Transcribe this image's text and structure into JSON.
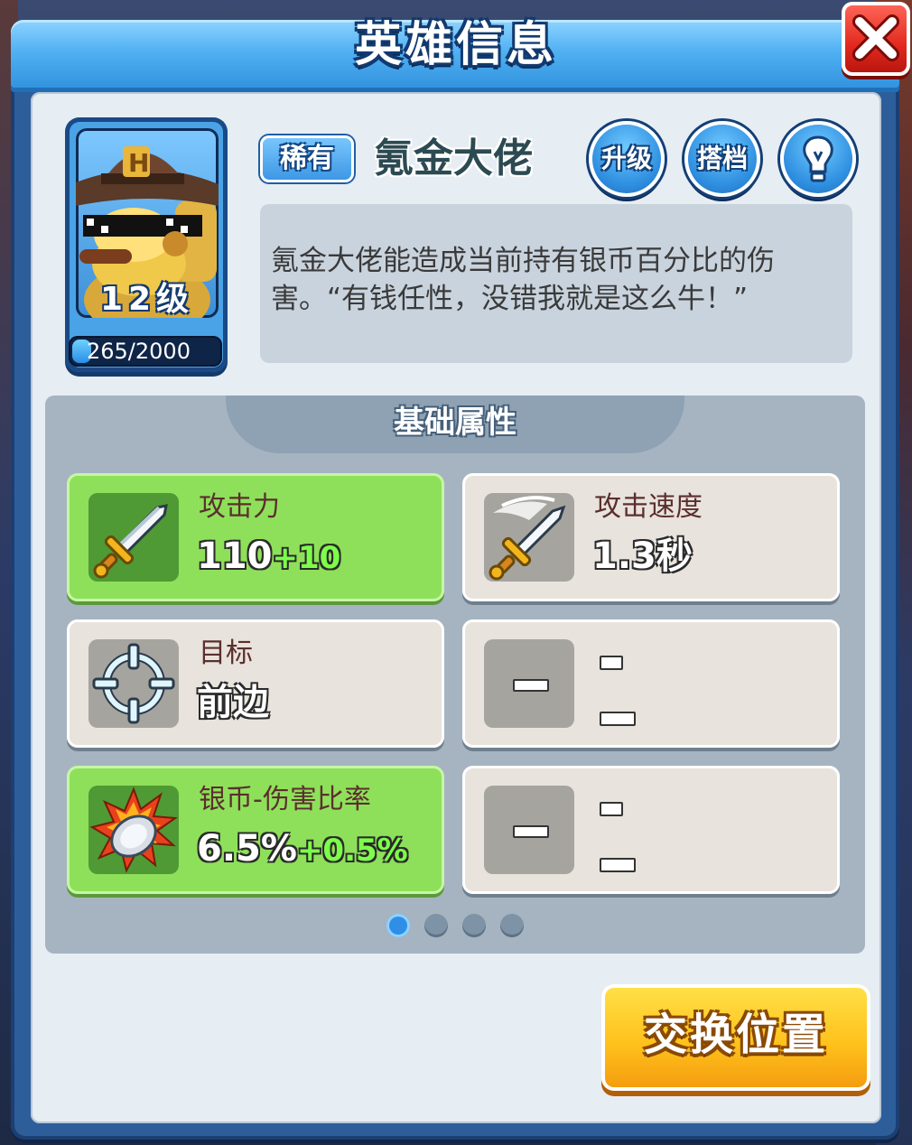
{
  "window": {
    "title": "英雄信息"
  },
  "hero": {
    "level_label": "12级",
    "xp_text": "265/2000",
    "xp_fraction": 0.1325,
    "rarity": "稀有",
    "name": "氪金大佬",
    "description": "氪金大佬能造成当前持有银币百分比的伤害。“有钱任性，没错我就是这么牛！”"
  },
  "actions": {
    "upgrade_label": "升级",
    "partner_label": "搭档",
    "swap_label": "交换位置"
  },
  "attributes": {
    "section_title": "基础属性",
    "cards": [
      {
        "label": "攻击力",
        "value": "110",
        "bonus": "+10",
        "icon": "sword-icon",
        "highlight": true
      },
      {
        "label": "攻击速度",
        "value": "1.3秒",
        "bonus": "",
        "icon": "swinging-sword-icon",
        "highlight": false
      },
      {
        "label": "目标",
        "value": "前边",
        "bonus": "",
        "icon": "crosshair-icon",
        "highlight": false
      },
      {
        "label": "",
        "value": "",
        "bonus": "",
        "icon": "empty-slot-icon",
        "highlight": false
      },
      {
        "label": "银币-伤害比率",
        "value": "6.5%",
        "bonus": "+0.5%",
        "icon": "silver-coin-burst-icon",
        "highlight": true
      },
      {
        "label": "",
        "value": "",
        "bonus": "",
        "icon": "empty-slot-icon",
        "highlight": false
      }
    ],
    "page_count": 4,
    "active_page": 1
  },
  "colors": {
    "panel_blue": "#2d5e9a",
    "highlight_green": "#8ee05a",
    "button_gold": "#ffc21c",
    "close_red": "#e2281d"
  }
}
